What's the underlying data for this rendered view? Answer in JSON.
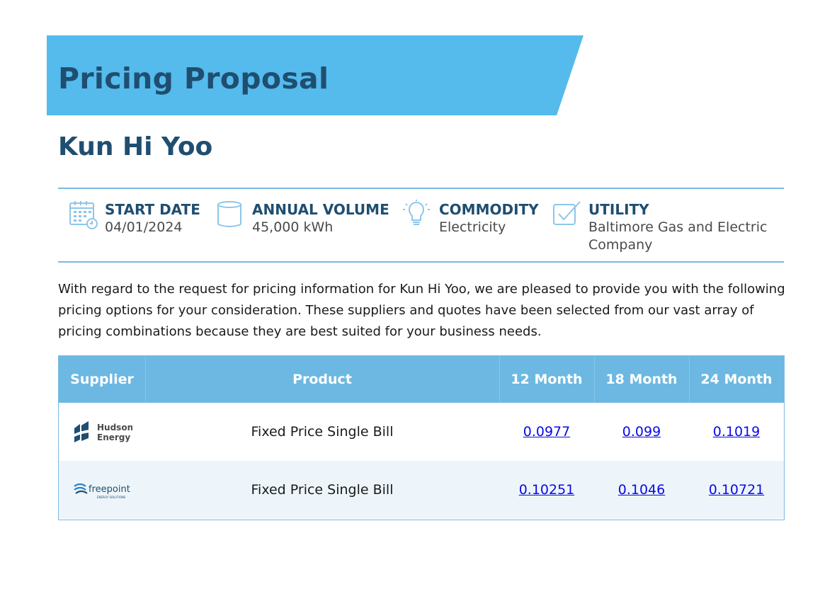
{
  "banner": {
    "title": "Pricing Proposal"
  },
  "client_name": "Kun Hi Yoo",
  "info": [
    {
      "icon": "calendar-icon",
      "label": "START DATE",
      "value": "04/01/2024"
    },
    {
      "icon": "cylinder-icon",
      "label": "ANNUAL VOLUME",
      "value": "45,000 kWh"
    },
    {
      "icon": "lightbulb-icon",
      "label": "COMMODITY",
      "value": "Electricity"
    },
    {
      "icon": "checkbox-icon",
      "label": "UTILITY",
      "value": "Baltimore Gas and Electric Company"
    }
  ],
  "intro": "With regard to the request for pricing information for Kun Hi Yoo, we are pleased to provide you with the following pricing options for your consideration. These suppliers and quotes have been selected from our vast array of pricing combinations because they are best suited for your business needs.",
  "table": {
    "headers": [
      "Supplier",
      "Product",
      "12 Month",
      "18 Month",
      "24 Month"
    ],
    "rows": [
      {
        "supplier_logo": {
          "line1": "Hudson",
          "line2": "Energy"
        },
        "product": "Fixed Price Single Bill",
        "prices": [
          "0.0977",
          "0.099",
          "0.1019"
        ]
      },
      {
        "supplier_logo": {
          "line1": "freepoint",
          "line2": "ENERGY SOLUTIONS"
        },
        "product": "Fixed Price Single Bill",
        "prices": [
          "0.10251",
          "0.1046",
          "0.10721"
        ]
      }
    ]
  },
  "colors": {
    "banner": "#54bbec",
    "heading": "#1f4e70",
    "table_header": "#6cb8e3",
    "link": "#0a0ae6",
    "alt_row": "#edf5fa"
  }
}
